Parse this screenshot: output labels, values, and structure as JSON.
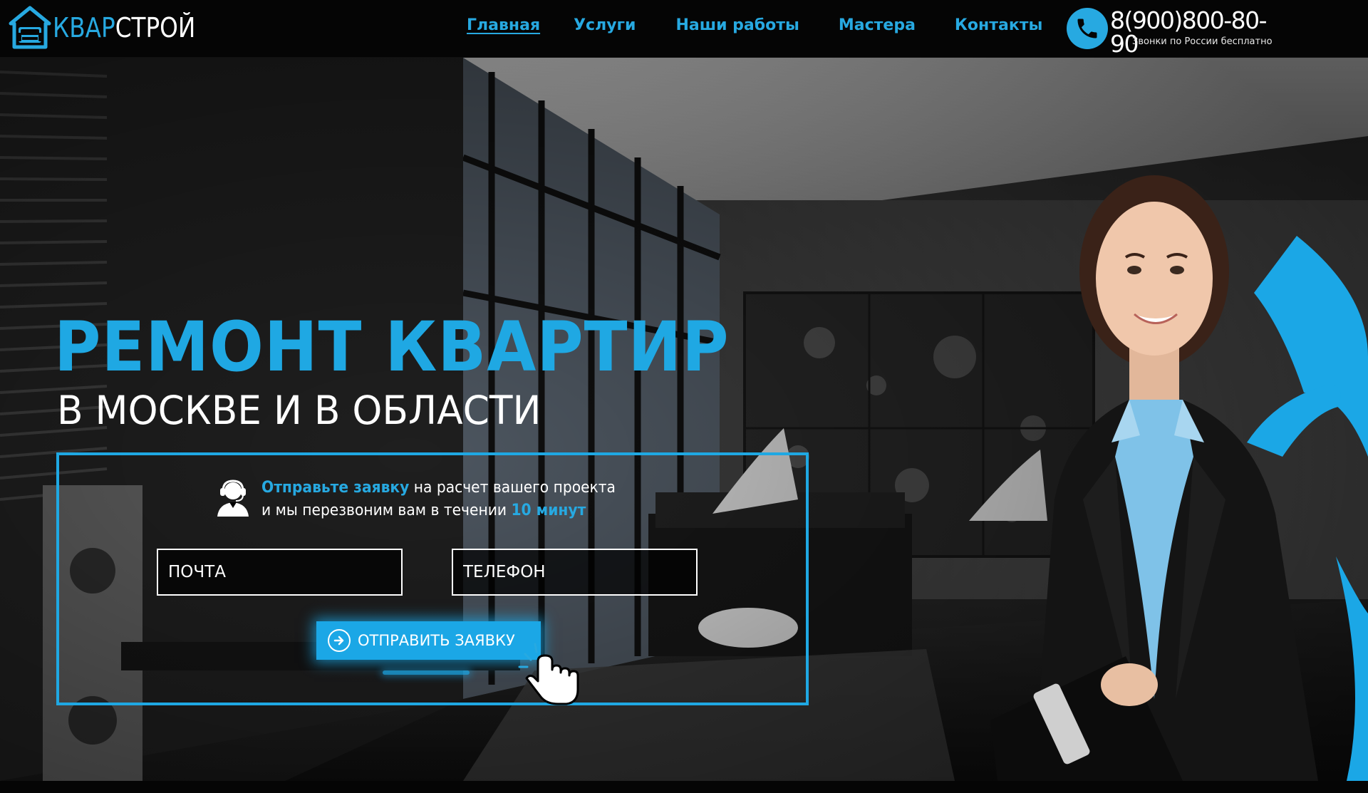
{
  "header": {
    "logo": {
      "part1": "КВАР",
      "part2": "СТРОЙ"
    },
    "nav": [
      {
        "label": "Главная",
        "active": true
      },
      {
        "label": "Услуги",
        "active": false
      },
      {
        "label": "Наши работы",
        "active": false
      },
      {
        "label": "Мастера",
        "active": false
      },
      {
        "label": "Контакты",
        "active": false
      }
    ],
    "phone": {
      "number": "8(900)800-80-90",
      "note": "Звонки по России бесплатно",
      "icon": "phone-icon"
    }
  },
  "hero": {
    "title": "РЕМОНТ КВАРТИР",
    "subtitle": "В МОСКВЕ И В ОБЛАСТИ",
    "form": {
      "operator_icon": "operator-headset-icon",
      "line1_highlight": "Отправьте заявку",
      "line1_rest": " на расчет вашего проекта",
      "line2_text": "и мы перезвоним вам в течении ",
      "line2_highlight": "10 минут",
      "email_placeholder": "ПОЧТА",
      "phone_placeholder": "ТЕЛЕФОН",
      "submit_label": "ОТПРАВИТЬ ЗАЯВКУ",
      "submit_icon": "arrow-right-circle-icon"
    }
  },
  "colors": {
    "accent": "#1fa8e3",
    "header_bg": "#050505",
    "text": "#ffffff"
  }
}
